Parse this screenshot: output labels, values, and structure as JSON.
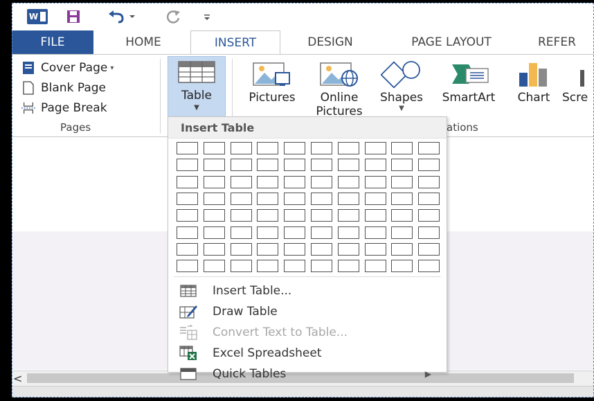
{
  "app": {
    "logo_letter": "W"
  },
  "tabs": [
    {
      "label": "FILE"
    },
    {
      "label": "HOME"
    },
    {
      "label": "INSERT"
    },
    {
      "label": "DESIGN"
    },
    {
      "label": "PAGE LAYOUT"
    },
    {
      "label": "REFER"
    }
  ],
  "pages_group": {
    "cover_page": "Cover Page",
    "blank_page": "Blank Page",
    "page_break": "Page Break",
    "label": "Pages"
  },
  "table_button": {
    "label": "Table"
  },
  "illustrations": {
    "pictures": "Pictures",
    "online_pictures_1": "Online",
    "online_pictures_2": "Pictures",
    "shapes": "Shapes",
    "smartart": "SmartArt",
    "chart": "Chart",
    "screenshot": "Scre",
    "group_label_partial": "ations"
  },
  "insert_table_menu": {
    "title": "Insert Table",
    "grid": {
      "columns": 10,
      "rows": 8
    },
    "items": [
      {
        "label": "Insert Table...",
        "icon": "table-grid-icon",
        "enabled": true
      },
      {
        "label": "Draw Table",
        "icon": "draw-table-icon",
        "enabled": true
      },
      {
        "label": "Convert Text to Table...",
        "icon": "convert-text-icon",
        "enabled": false
      },
      {
        "label": "Excel Spreadsheet",
        "icon": "excel-icon",
        "enabled": true
      },
      {
        "label": "Quick Tables",
        "icon": "quick-tables-icon",
        "enabled": true
      }
    ]
  },
  "colors": {
    "accent": "#2b579a",
    "table_button_bg": "#c5d9f1",
    "excel_green": "#217346"
  }
}
